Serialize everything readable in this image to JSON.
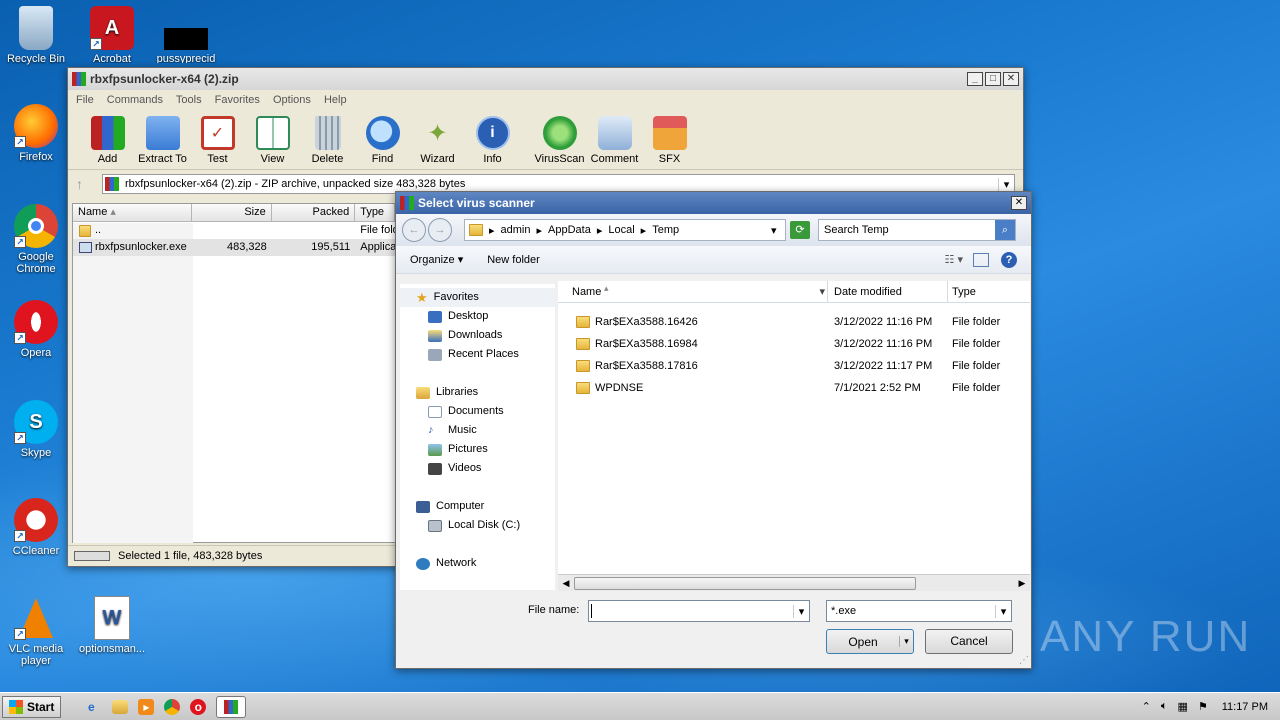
{
  "desktop": {
    "icons": [
      {
        "label": "Recycle Bin",
        "icon": "recycle-bin-icon"
      },
      {
        "label": "Acrobat",
        "icon": "acrobat-icon"
      },
      {
        "label": "pussyprecid",
        "icon": "redacted-file-icon"
      },
      {
        "label": "Firefox",
        "icon": "firefox-icon"
      },
      {
        "label": "Google Chrome",
        "icon": "chrome-icon"
      },
      {
        "label": "Opera",
        "icon": "opera-icon"
      },
      {
        "label": "Skype",
        "icon": "skype-icon"
      },
      {
        "label": "CCleaner",
        "icon": "ccleaner-icon"
      },
      {
        "label": "VLC media player",
        "icon": "vlc-icon"
      },
      {
        "label": "optionsman...",
        "icon": "word-document-icon"
      }
    ]
  },
  "winrar": {
    "title": "rbxfpsunlocker-x64 (2).zip",
    "menu": [
      "File",
      "Commands",
      "Tools",
      "Favorites",
      "Options",
      "Help"
    ],
    "toolbar": [
      {
        "label": "Add",
        "icon": "add-archive-icon",
        "color": "#b03030"
      },
      {
        "label": "Extract To",
        "icon": "extract-folder-icon",
        "color": "#3a7bd5"
      },
      {
        "label": "Test",
        "icon": "test-clipboard-icon",
        "color": "#c0392b"
      },
      {
        "label": "View",
        "icon": "view-book-icon",
        "color": "#2e8b57"
      },
      {
        "label": "Delete",
        "icon": "trash-icon",
        "color": "#8a9aa8"
      },
      {
        "label": "Find",
        "icon": "magnifier-icon",
        "color": "#2a6fc9"
      },
      {
        "label": "Wizard",
        "icon": "wand-icon",
        "color": "#7aa63a"
      },
      {
        "label": "Info",
        "icon": "info-icon",
        "color": "#2a5fb4"
      },
      {
        "label": "VirusScan",
        "icon": "virus-scan-icon",
        "color": "#2e9e3a"
      },
      {
        "label": "Comment",
        "icon": "comment-icon",
        "color": "#6c8fb8"
      },
      {
        "label": "SFX",
        "icon": "sfx-box-icon",
        "color": "#d9892a"
      }
    ],
    "path": "rbxfpsunlocker-x64 (2).zip - ZIP archive, unpacked size 483,328 bytes",
    "columns": {
      "name": "Name",
      "size": "Size",
      "packed": "Packed",
      "type": "Type"
    },
    "files": [
      {
        "name": "..",
        "size": "",
        "packed": "",
        "type": "File fold"
      },
      {
        "name": "rbxfpsunlocker.exe",
        "size": "483,328",
        "packed": "195,511",
        "type": "Applica"
      }
    ],
    "status": "Selected 1 file, 483,328 bytes"
  },
  "dialog": {
    "title": "Select virus scanner",
    "breadcrumb": [
      "admin",
      "AppData",
      "Local",
      "Temp"
    ],
    "search_placeholder": "Search Temp",
    "organize_label": "Organize",
    "new_folder_label": "New folder",
    "nav": {
      "favorites": {
        "label": "Favorites",
        "items": [
          "Desktop",
          "Downloads",
          "Recent Places"
        ]
      },
      "libraries": {
        "label": "Libraries",
        "items": [
          "Documents",
          "Music",
          "Pictures",
          "Videos"
        ]
      },
      "computer": {
        "label": "Computer",
        "items": [
          "Local Disk (C:)"
        ]
      },
      "network": {
        "label": "Network"
      }
    },
    "columns": {
      "name": "Name",
      "date": "Date modified",
      "type": "Type"
    },
    "rows": [
      {
        "name": "Rar$EXa3588.16426",
        "date": "3/12/2022 11:16 PM",
        "type": "File folder"
      },
      {
        "name": "Rar$EXa3588.16984",
        "date": "3/12/2022 11:16 PM",
        "type": "File folder"
      },
      {
        "name": "Rar$EXa3588.17816",
        "date": "3/12/2022 11:17 PM",
        "type": "File folder"
      },
      {
        "name": "WPDNSE",
        "date": "7/1/2021 2:52 PM",
        "type": "File folder"
      }
    ],
    "filename_label": "File name:",
    "filename_value": "",
    "filter_value": "*.exe",
    "open_label": "Open",
    "cancel_label": "Cancel"
  },
  "taskbar": {
    "start_label": "Start",
    "clock": "11:17 PM"
  },
  "watermark": "ANY RUN"
}
